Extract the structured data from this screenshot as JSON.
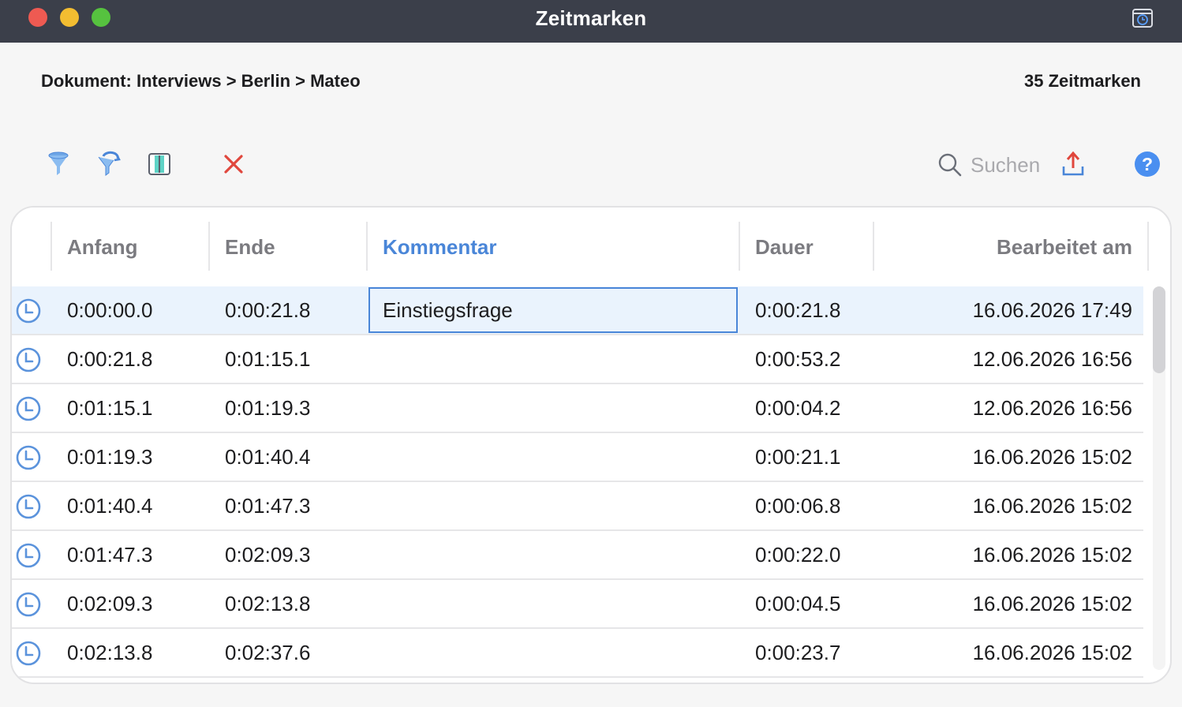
{
  "window": {
    "title": "Zeitmarken",
    "colors": {
      "titlebar": "#3b3f4a",
      "accent": "#4a86d8",
      "delete": "#e0473d"
    }
  },
  "header": {
    "document_path": "Dokument: Interviews > Berlin > Mateo",
    "count": "35 Zeitmarken"
  },
  "toolbar": {
    "icons": [
      "filter-icon",
      "filter-reset-icon",
      "columns-icon",
      "delete-icon",
      "search-icon",
      "export-icon",
      "help-icon"
    ],
    "search_placeholder": "Suchen",
    "help_label": "?"
  },
  "table": {
    "columns": [
      "Anfang",
      "Ende",
      "Kommentar",
      "Dauer",
      "Bearbeitet am"
    ],
    "sorted_column": "Kommentar",
    "rows": [
      {
        "anfang": "0:00:00.0",
        "ende": "0:00:21.8",
        "kommentar": "Einstiegsfrage",
        "dauer": "0:00:21.8",
        "bearbeitet": "16.06.2026 17:49",
        "selected": true
      },
      {
        "anfang": "0:00:21.8",
        "ende": "0:01:15.1",
        "kommentar": "",
        "dauer": "0:00:53.2",
        "bearbeitet": "12.06.2026 16:56"
      },
      {
        "anfang": "0:01:15.1",
        "ende": "0:01:19.3",
        "kommentar": "",
        "dauer": "0:00:04.2",
        "bearbeitet": "12.06.2026 16:56"
      },
      {
        "anfang": "0:01:19.3",
        "ende": "0:01:40.4",
        "kommentar": "",
        "dauer": "0:00:21.1",
        "bearbeitet": "16.06.2026 15:02"
      },
      {
        "anfang": "0:01:40.4",
        "ende": "0:01:47.3",
        "kommentar": "",
        "dauer": "0:00:06.8",
        "bearbeitet": "16.06.2026 15:02"
      },
      {
        "anfang": "0:01:47.3",
        "ende": "0:02:09.3",
        "kommentar": "",
        "dauer": "0:00:22.0",
        "bearbeitet": "16.06.2026 15:02"
      },
      {
        "anfang": "0:02:09.3",
        "ende": "0:02:13.8",
        "kommentar": "",
        "dauer": "0:00:04.5",
        "bearbeitet": "16.06.2026 15:02"
      },
      {
        "anfang": "0:02:13.8",
        "ende": "0:02:37.6",
        "kommentar": "",
        "dauer": "0:00:23.7",
        "bearbeitet": "16.06.2026 15:02"
      }
    ]
  }
}
